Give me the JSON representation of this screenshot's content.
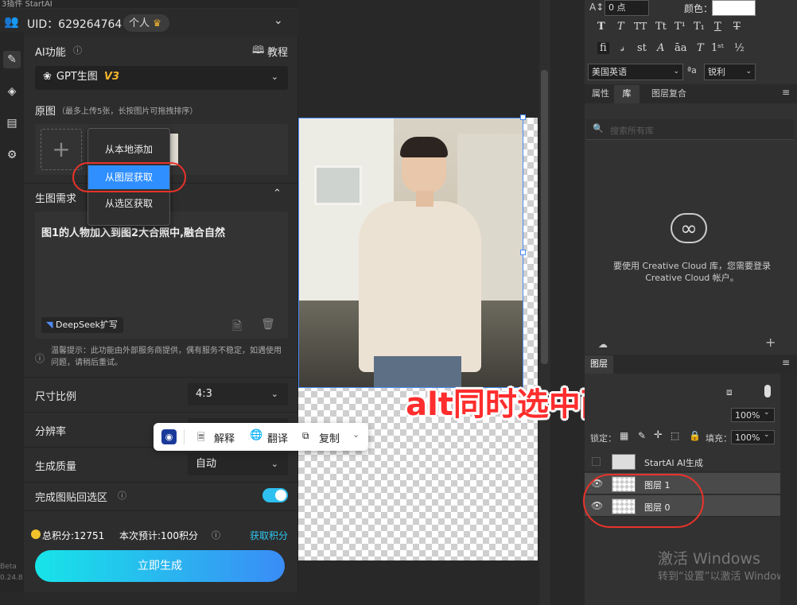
{
  "plugin": {
    "title": "3插件 StartAI",
    "uid": "UID：629264764",
    "account_type": "个人",
    "ai_function_label": "AI功能",
    "tutorial": "教程",
    "model_selected": "GPT生图",
    "model_version": "V3",
    "source_label": "原图",
    "source_hint": "（最多上传5张，长按图片可拖拽排序）",
    "dropdown": [
      "从本地添加",
      "从图层获取",
      "从选区获取"
    ],
    "prompt_label": "生图需求",
    "prompt_text": "图1的人物加入到图2大合照中,融合自然",
    "deepseek_label": "DeepSeek扩写",
    "notice": "温馨提示：此功能由外部服务商提供，偶有服务不稳定，如遇使用问题，请稍后重试。",
    "ratio_label": "尺寸比例",
    "ratio_value": "4:3",
    "resolution_label": "分辨率",
    "quality_label": "生成质量",
    "quality_value": "自动",
    "paste_back_label": "完成图贴回选区",
    "paste_back_on": true,
    "points_total": "总积分:12751",
    "points_estimate": "本次预计:100积分",
    "get_points": "获取积分",
    "generate": "立即生成",
    "beta": "Beta",
    "version": "0.24.8"
  },
  "context_bar": {
    "explain": "解释",
    "translate": "翻译",
    "copy": "复制"
  },
  "banner": "alt同时选中两个图层",
  "right_panel": {
    "font_size": "0 点",
    "color_label": "颜色：",
    "lang": "美国英语",
    "antialias_prefix": "ªa",
    "antialias": "锐利",
    "tabs": [
      "属性",
      "库",
      "图层复合"
    ],
    "search_placeholder": "搜索所有库",
    "cc_message": "要使用 Creative Cloud 库，您需要登录 Creative Cloud 帐户。",
    "layers_tab": "图层",
    "opacity_value": "100%",
    "lock_label": "锁定：",
    "fill_label": "填充：",
    "fill_value": "100%",
    "layers": [
      {
        "name": "StartAI AI生成",
        "visible": false
      },
      {
        "name": "图层 1",
        "visible": true
      },
      {
        "name": "图层 0",
        "visible": true
      }
    ],
    "activate_title": "激活 Windows",
    "activate_sub": "转到“设置”以激活 Windows。"
  },
  "colors": {
    "accent": "#2f8fff",
    "annotation_red": "#e8332a",
    "gradient_start": "#17e4e8",
    "gradient_end": "#3a8cf6"
  }
}
